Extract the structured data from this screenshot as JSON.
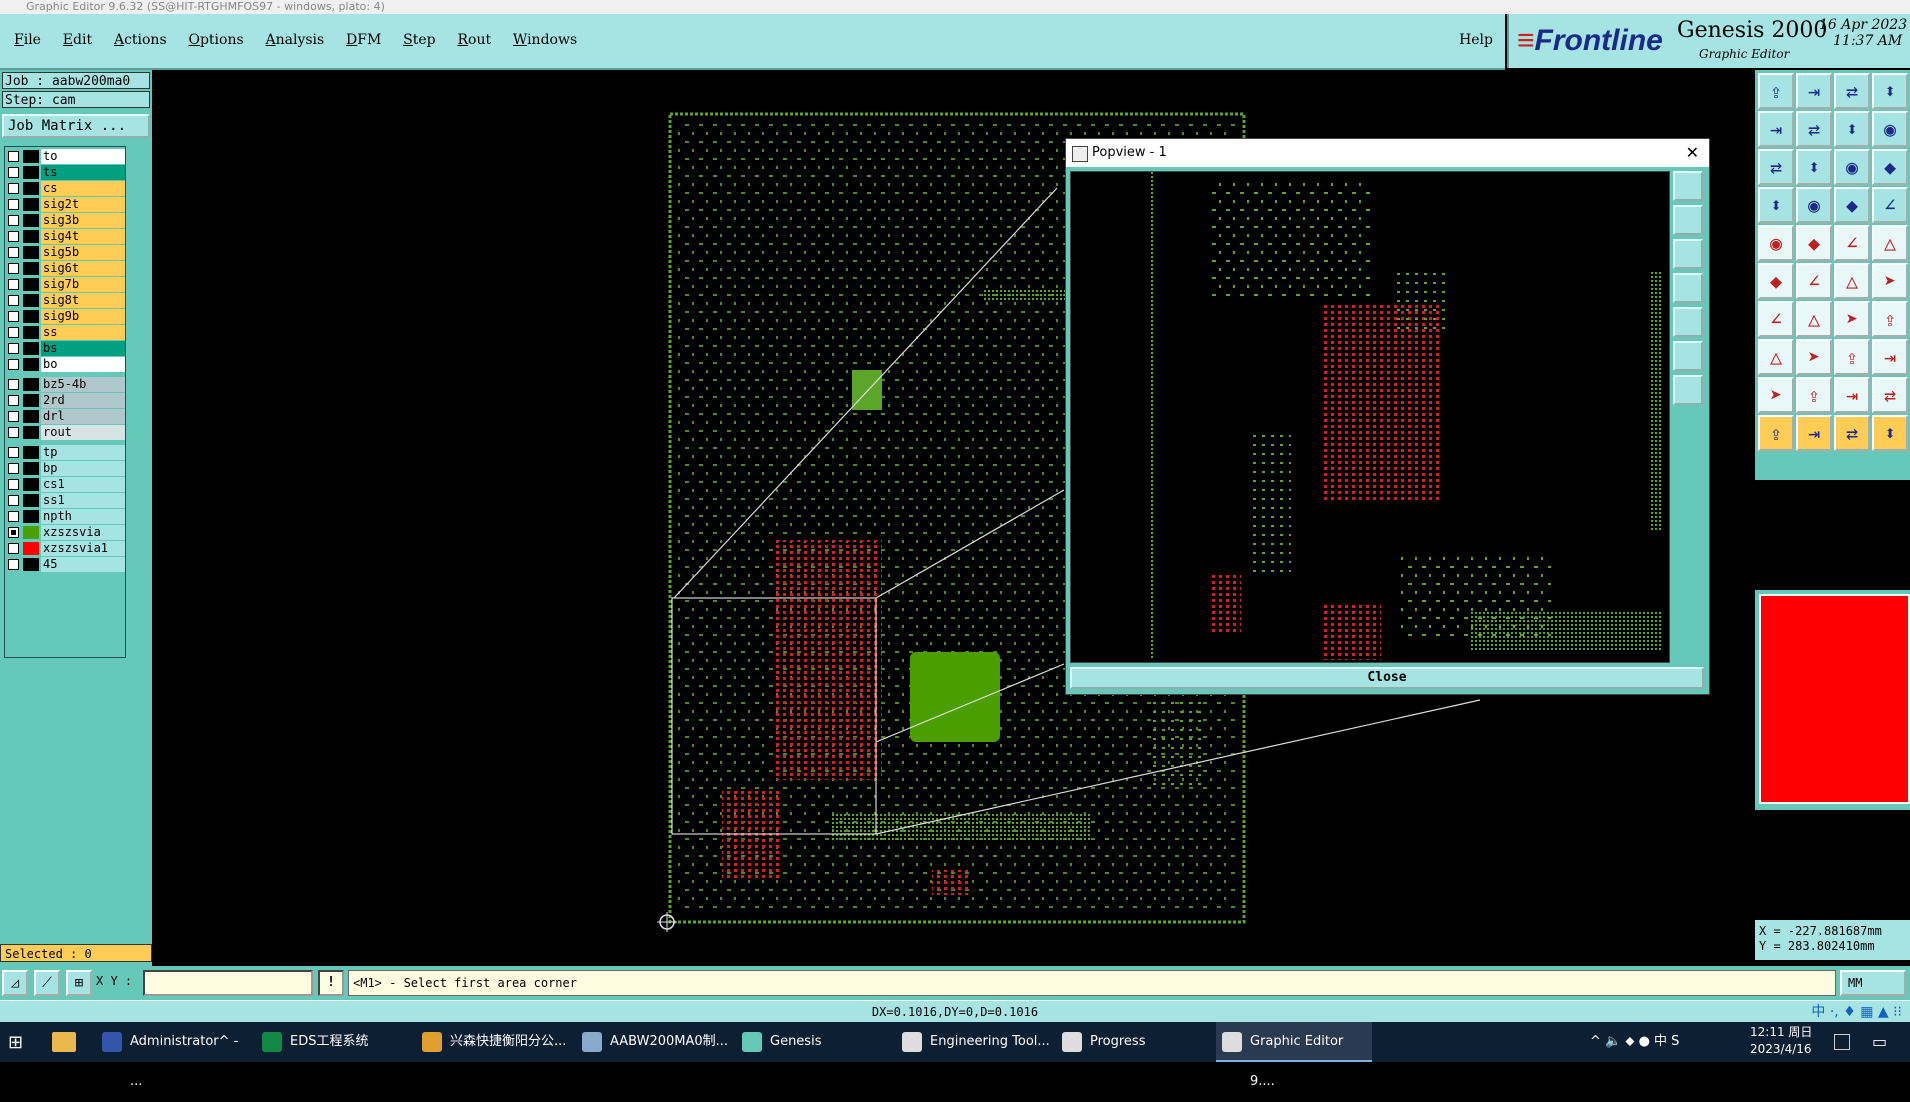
{
  "window": {
    "title": "Graphic Editor 9.6.32 (SS@HIT-RTGHMFOS97 - windows, plato: 4)"
  },
  "menu": {
    "items": [
      "File",
      "Edit",
      "Actions",
      "Options",
      "Analysis",
      "DFM",
      "Step",
      "Rout",
      "Windows"
    ],
    "help": "Help"
  },
  "brand": {
    "logo": "Frontline",
    "product": "Genesis 2000",
    "subtitle": "Graphic Editor",
    "date": "16 Apr 2023",
    "time": "11:37 AM"
  },
  "job": {
    "job_line": "Job : aabw200ma0",
    "step_line": "Step: cam",
    "matrix_button": "Job Matrix ..."
  },
  "layers": [
    {
      "name": "to",
      "bg": "#ffffff",
      "swatch": "#000000",
      "checked": false
    },
    {
      "name": "ts",
      "bg": "#00a080",
      "swatch": "#000000",
      "checked": false
    },
    {
      "name": "cs",
      "bg": "#ffcc55",
      "swatch": "#000000",
      "checked": false
    },
    {
      "name": "sig2t",
      "bg": "#ffcc55",
      "swatch": "#000000",
      "checked": false
    },
    {
      "name": "sig3b",
      "bg": "#ffcc55",
      "swatch": "#000000",
      "checked": false
    },
    {
      "name": "sig4t",
      "bg": "#ffcc55",
      "swatch": "#000000",
      "checked": false
    },
    {
      "name": "sig5b",
      "bg": "#ffcc55",
      "swatch": "#000000",
      "checked": false
    },
    {
      "name": "sig6t",
      "bg": "#ffcc55",
      "swatch": "#000000",
      "checked": false
    },
    {
      "name": "sig7b",
      "bg": "#ffcc55",
      "swatch": "#000000",
      "checked": false
    },
    {
      "name": "sig8t",
      "bg": "#ffcc55",
      "swatch": "#000000",
      "checked": false
    },
    {
      "name": "sig9b",
      "bg": "#ffcc55",
      "swatch": "#000000",
      "checked": false
    },
    {
      "name": "ss",
      "bg": "#ffcc55",
      "swatch": "#000000",
      "checked": false
    },
    {
      "name": "bs",
      "bg": "#00a080",
      "swatch": "#000000",
      "checked": false
    },
    {
      "name": "bo",
      "bg": "#ffffff",
      "swatch": "#000000",
      "checked": false
    },
    {
      "name": "bz5-4b",
      "bg": "#b0c8cc",
      "swatch": "#000000",
      "checked": false,
      "gap": true
    },
    {
      "name": "2rd",
      "bg": "#b0c8cc",
      "swatch": "#000000",
      "checked": false
    },
    {
      "name": "drl",
      "bg": "#b0c8cc",
      "swatch": "#000000",
      "checked": false
    },
    {
      "name": "rout",
      "bg": "#d8e4e4",
      "swatch": "#000000",
      "checked": false
    },
    {
      "name": "tp",
      "bg": "#a6e3e3",
      "swatch": "#000000",
      "checked": false,
      "gap": true
    },
    {
      "name": "bp",
      "bg": "#a6e3e3",
      "swatch": "#000000",
      "checked": false
    },
    {
      "name": "cs1",
      "bg": "#a6e3e3",
      "swatch": "#000000",
      "checked": false
    },
    {
      "name": "ss1",
      "bg": "#a6e3e3",
      "swatch": "#000000",
      "checked": false
    },
    {
      "name": "npth",
      "bg": "#a6e3e3",
      "swatch": "#000000",
      "checked": false
    },
    {
      "name": "xzszsvia",
      "bg": "#a6e3e3",
      "swatch": "#4aa000",
      "checked": true
    },
    {
      "name": "xzszsvia1",
      "bg": "#a6e3e3",
      "swatch": "#ff0000",
      "checked": false
    },
    {
      "name": "45",
      "bg": "#a6e3e3",
      "swatch": "#000000",
      "checked": false
    }
  ],
  "selected": "Selected : 0",
  "popview": {
    "title": "Popview - 1",
    "close_label": "Close"
  },
  "command": {
    "xy_label": "X Y :",
    "xy_value": "",
    "message": "<M1> - Select first area corner",
    "units": "MM"
  },
  "coords": {
    "x": "X = -227.881687mm",
    "y": "Y = 283.802410mm"
  },
  "status": "DX=0.1016,DY=0,D=0.1016",
  "ime": "中 ·, ♦ ▦ ▲ ⁝⁝",
  "taskbar": {
    "items": [
      {
        "label": "Administrator^ - ...",
        "color": "#3355aa"
      },
      {
        "label": "EDS工程系统",
        "color": "#118844"
      },
      {
        "label": "兴森快捷衡阳分公...",
        "color": "#e0a030"
      },
      {
        "label": "AABW200MA0制...",
        "color": "#88aacc"
      },
      {
        "label": "Genesis",
        "color": "#66c8b8"
      },
      {
        "label": "Engineering Tool...",
        "color": "#dddddd"
      },
      {
        "label": "Progress",
        "color": "#dddddd"
      },
      {
        "label": "Graphic Editor 9....",
        "color": "#dddddd",
        "active": true
      }
    ],
    "tray": "^  🔈  ⬥  ●  中  S",
    "time": "12:11 周日",
    "date": "2023/4/16"
  },
  "colors": {
    "board_green": "#5aa52a",
    "pad_red": "#d42020",
    "panel_teal": "#66c8b8",
    "panel_light": "#a6e3e3"
  }
}
